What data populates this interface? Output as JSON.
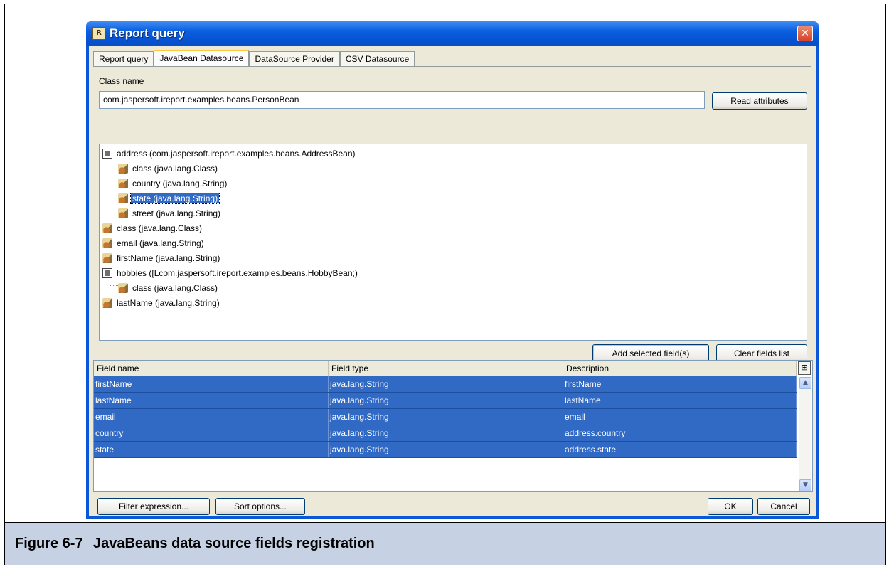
{
  "window": {
    "title": "Report query",
    "title_icon": "report-icon",
    "close_icon": "close-icon"
  },
  "tabs": [
    {
      "label": "Report query",
      "active": false
    },
    {
      "label": "JavaBean Datasource",
      "active": true
    },
    {
      "label": "DataSource Provider",
      "active": false
    },
    {
      "label": "CSV Datasource",
      "active": false
    }
  ],
  "class_name": {
    "label": "Class name",
    "value": "com.jaspersoft.ireport.examples.beans.PersonBean",
    "read_button": "Read attributes"
  },
  "tree": {
    "items": [
      {
        "label": "address (com.jaspersoft.ireport.examples.beans.AddressBean)",
        "icon": "node-icon",
        "level": 0,
        "selected": false
      },
      {
        "label": "class (java.lang.Class)",
        "icon": "bean-icon",
        "level": 1,
        "selected": false
      },
      {
        "label": "country (java.lang.String)",
        "icon": "bean-icon",
        "level": 1,
        "selected": false
      },
      {
        "label": "state (java.lang.String)",
        "icon": "bean-icon",
        "level": 1,
        "selected": true
      },
      {
        "label": "street (java.lang.String)",
        "icon": "bean-icon",
        "level": 1,
        "selected": false
      },
      {
        "label": "class (java.lang.Class)",
        "icon": "bean-icon",
        "level": 0,
        "selected": false
      },
      {
        "label": "email (java.lang.String)",
        "icon": "bean-icon",
        "level": 0,
        "selected": false
      },
      {
        "label": "firstName (java.lang.String)",
        "icon": "bean-icon",
        "level": 0,
        "selected": false
      },
      {
        "label": "hobbies ([Lcom.jaspersoft.ireport.examples.beans.HobbyBean;)",
        "icon": "node-icon",
        "level": 0,
        "selected": false
      },
      {
        "label": "class (java.lang.Class)",
        "icon": "bean-icon",
        "level": 1,
        "selected": false
      },
      {
        "label": "lastName (java.lang.String)",
        "icon": "bean-icon",
        "level": 0,
        "selected": false
      }
    ]
  },
  "tree_buttons": {
    "add": "Add selected field(s)",
    "clear": "Clear fields list"
  },
  "fields_table": {
    "columns": [
      "Field name",
      "Field type",
      "Description"
    ],
    "rows": [
      [
        "firstName",
        "java.lang.String",
        "firstName"
      ],
      [
        "lastName",
        "java.lang.String",
        "lastName"
      ],
      [
        "email",
        "java.lang.String",
        "email"
      ],
      [
        "country",
        "java.lang.String",
        "address.country"
      ],
      [
        "state",
        "java.lang.String",
        "address.state"
      ]
    ]
  },
  "bottom_buttons": {
    "filter": "Filter expression...",
    "sort": "Sort options...",
    "ok": "OK",
    "cancel": "Cancel"
  },
  "caption": {
    "number": "Figure 6-7",
    "text": "JavaBeans data source fields registration"
  },
  "colors": {
    "selection": "#316ac5",
    "title_bar": "#0b5fe0",
    "caption_bg": "#c7d1e4",
    "dialog_bg": "#ece9d8"
  }
}
